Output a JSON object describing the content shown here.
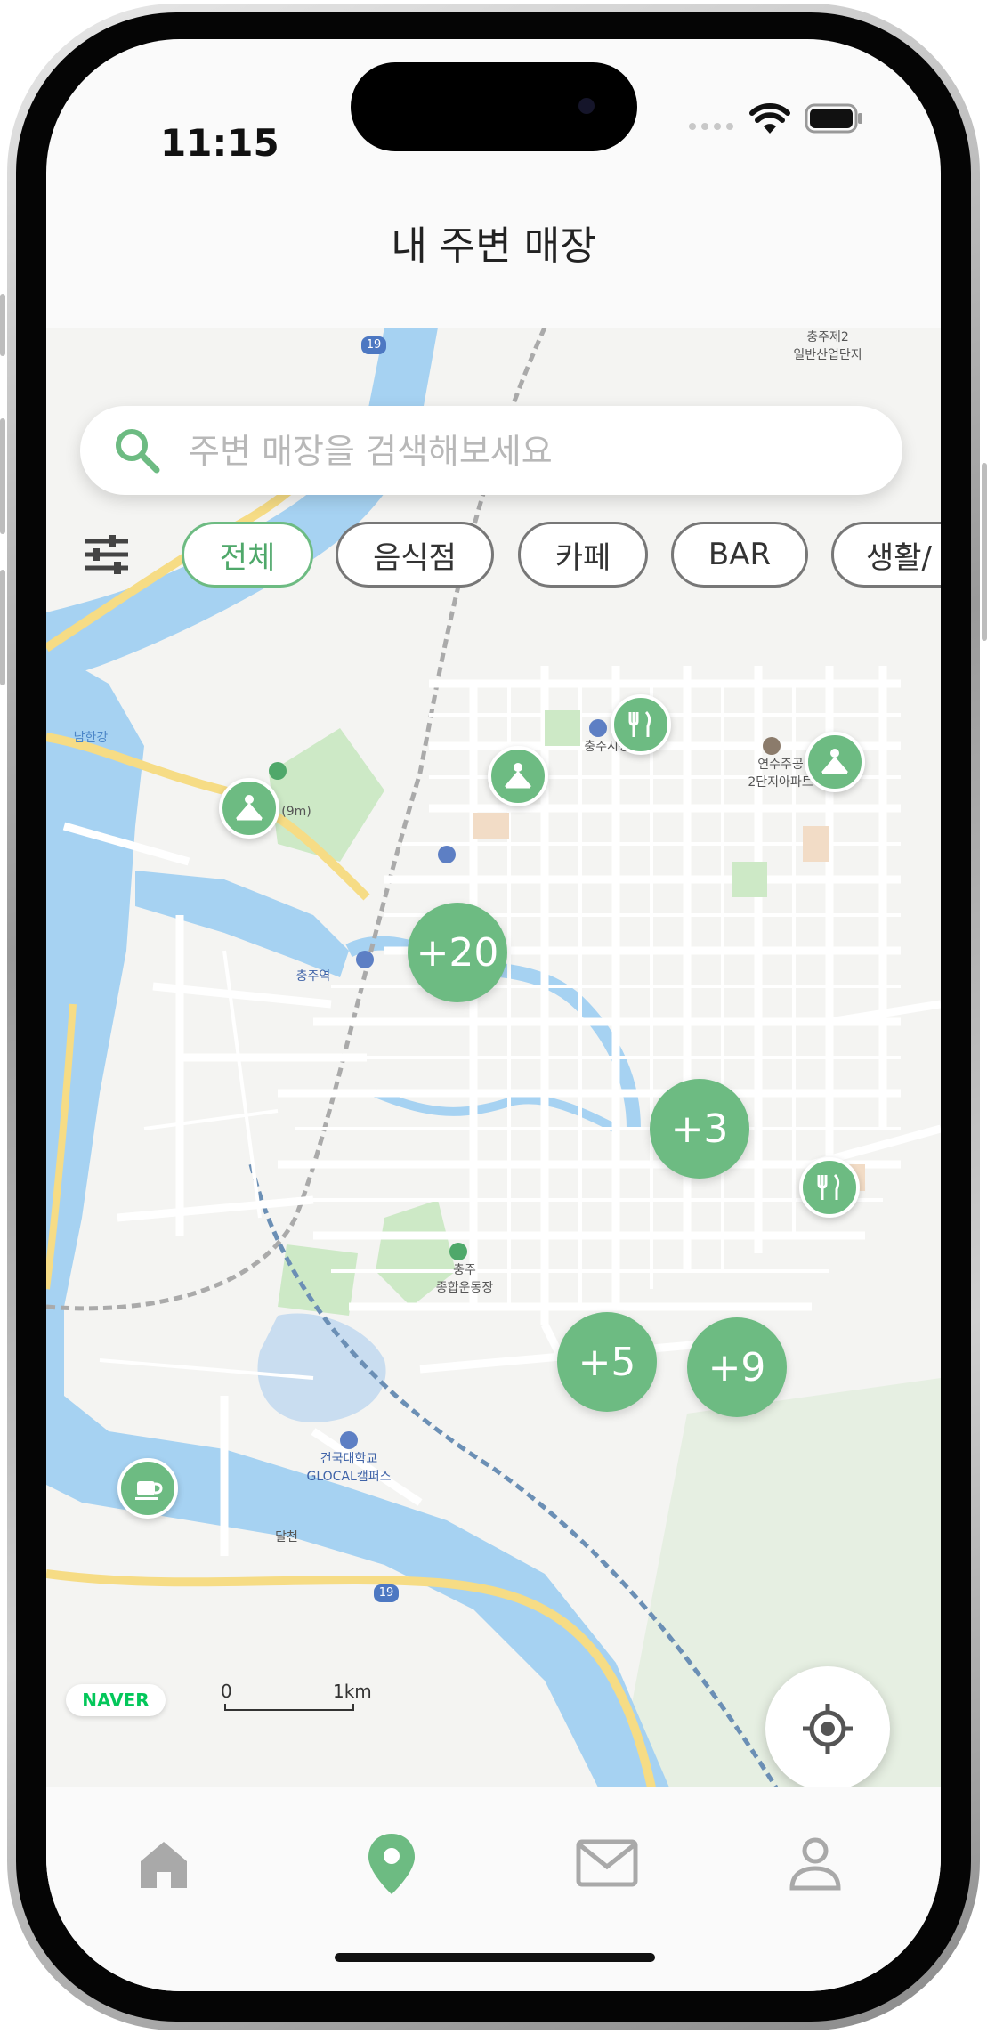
{
  "status_bar": {
    "time": "11:15"
  },
  "header": {
    "title": "내 주변 매장"
  },
  "search": {
    "placeholder": "주변 매장을 검색해보세요"
  },
  "filters": {
    "items": [
      {
        "label": "전체",
        "active": true
      },
      {
        "label": "음식점",
        "active": false
      },
      {
        "label": "카페",
        "active": false
      },
      {
        "label": "BAR",
        "active": false
      },
      {
        "label": "생활/",
        "active": false
      }
    ]
  },
  "map": {
    "clusters": [
      "+20",
      "+3",
      "+5",
      "+9"
    ],
    "labels": {
      "industrial": "충주제2\n일반산업단지",
      "river": "남한강",
      "station": "충주역",
      "apartment": "연수주공\n2단지아파트",
      "city_hall": "충주시청",
      "stadium": "충주\n종합운동장",
      "university": "건국대학교\nGLOCAL캠퍼스",
      "dalcheon": "달천",
      "mountain": "(9m)",
      "road19a": "19",
      "road19b": "19",
      "scale_start": "0",
      "scale_end": "1km"
    },
    "provider": "NAVER"
  },
  "tabs": [
    {
      "name": "home",
      "icon": "home-icon",
      "active": false
    },
    {
      "name": "map",
      "icon": "location-pin-icon",
      "active": true
    },
    {
      "name": "messages",
      "icon": "mail-icon",
      "active": false
    },
    {
      "name": "profile",
      "icon": "person-icon",
      "active": false
    }
  ],
  "colors": {
    "accent": "#6dbb82",
    "river": "#a6d2f2",
    "park": "#cde9c6"
  }
}
